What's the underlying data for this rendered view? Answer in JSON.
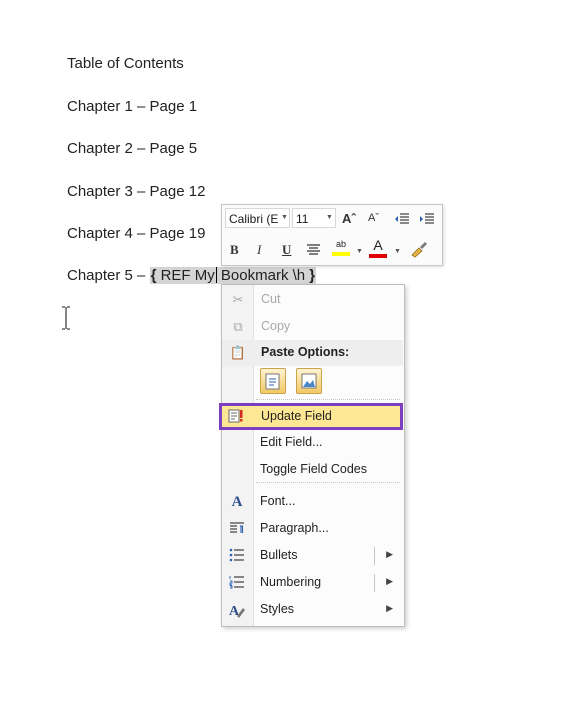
{
  "document": {
    "lines": [
      "Table of Contents",
      "Chapter 1 – Page 1",
      "Chapter 2 – Page 5",
      "Chapter 3 – Page 12",
      "Chapter 4 – Page 19"
    ],
    "chapter5_prefix": "Chapter 5 – ",
    "field_open": "{",
    "field_code_a": " REF My",
    "field_code_b": " Bookmark \\h ",
    "field_close": "}"
  },
  "mini_toolbar": {
    "font_name": "Calibri (E",
    "font_size": "11",
    "grow_font": "Aˆ",
    "shrink_font": "Aˇ",
    "bold": "B",
    "italic": "I",
    "underline": "U",
    "highlight_color": "#ffff00",
    "font_color": "#e00000"
  },
  "context_menu": {
    "items": [
      {
        "label": "Cut",
        "icon": "scissors-icon",
        "disabled": true
      },
      {
        "label": "Copy",
        "icon": "copy-icon",
        "disabled": true
      },
      {
        "label": "Paste Options:",
        "icon": "paste-icon"
      },
      {
        "label": "Update Field",
        "icon": "update-field-icon",
        "highlighted": true
      },
      {
        "label": "Edit Field...",
        "icon": ""
      },
      {
        "label": "Toggle Field Codes",
        "icon": ""
      },
      {
        "label": "Font...",
        "icon": "font-icon"
      },
      {
        "label": "Paragraph...",
        "icon": "paragraph-icon"
      },
      {
        "label": "Bullets",
        "icon": "bullets-icon",
        "submenu": true
      },
      {
        "label": "Numbering",
        "icon": "numbering-icon",
        "submenu": true
      },
      {
        "label": "Styles",
        "icon": "styles-icon",
        "submenu": true
      }
    ],
    "highlight_border_color": "#7b3fbf",
    "highlight_fill_color": "#fde694"
  }
}
